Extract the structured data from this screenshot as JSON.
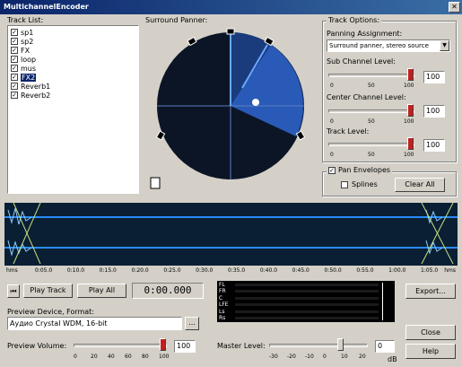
{
  "window": {
    "title": "MultichannelEncoder"
  },
  "track_list": {
    "label": "Track List:",
    "items": [
      {
        "label": "sp1",
        "checked": true,
        "selected": false
      },
      {
        "label": "sp2",
        "checked": true,
        "selected": false
      },
      {
        "label": "FX",
        "checked": true,
        "selected": false
      },
      {
        "label": "loop",
        "checked": true,
        "selected": false
      },
      {
        "label": "mus",
        "checked": true,
        "selected": false
      },
      {
        "label": "FX2",
        "checked": true,
        "selected": true
      },
      {
        "label": "Reverb1",
        "checked": true,
        "selected": false
      },
      {
        "label": "Reverb2",
        "checked": true,
        "selected": false
      }
    ]
  },
  "panner": {
    "label": "Surround Panner:"
  },
  "track_options": {
    "group_label": "Track Options:",
    "panning_label": "Panning Assignment:",
    "panning_value": "Surround panner, stereo source",
    "sub_label": "Sub Channel Level:",
    "sub_value": "100",
    "sub_ticks": [
      "0",
      "50",
      "100"
    ],
    "center_label": "Center Channel Level:",
    "center_value": "100",
    "center_ticks": [
      "0",
      "50",
      "100"
    ],
    "track_level_label": "Track Level:",
    "track_level_value": "100",
    "track_level_ticks": [
      "0",
      "50",
      "100"
    ],
    "pan_envelopes_label": "Pan Envelopes",
    "splines_label": "Splines",
    "clear_all_label": "Clear All"
  },
  "timeline": {
    "start_label": "hms",
    "end_label": "hms",
    "ticks": [
      "0:05.0",
      "0:10.0",
      "0:15.0",
      "0:20.0",
      "0:25.0",
      "0:30.0",
      "0:35.0",
      "0:40.0",
      "0:45.0",
      "0:50.0",
      "0:55.0",
      "1:00.0",
      "1:05.0"
    ]
  },
  "transport": {
    "goto_start_icon": "skip-to-start-icon",
    "play_track_label": "Play Track",
    "play_all_label": "Play All",
    "time_display": "0:00.000"
  },
  "preview_device": {
    "label": "Preview Device, Format:",
    "value": "Аудио Crystal WDM, 16-bit",
    "browse_label": "..."
  },
  "preview_volume": {
    "label": "Preview Volume:",
    "value": "100",
    "ticks": [
      "0",
      "20",
      "40",
      "60",
      "80",
      "100"
    ]
  },
  "meter": {
    "channels": [
      "FL",
      "FR",
      "C",
      "LFE",
      "Ls",
      "Rs"
    ]
  },
  "master_level": {
    "label": "Master Level:",
    "value": "0",
    "unit": "dB",
    "ticks": [
      "-30",
      "-20",
      "-10",
      "0",
      "10",
      "20"
    ]
  },
  "buttons": {
    "export_label": "Export...",
    "close_label": "Close",
    "help_label": "Help"
  }
}
